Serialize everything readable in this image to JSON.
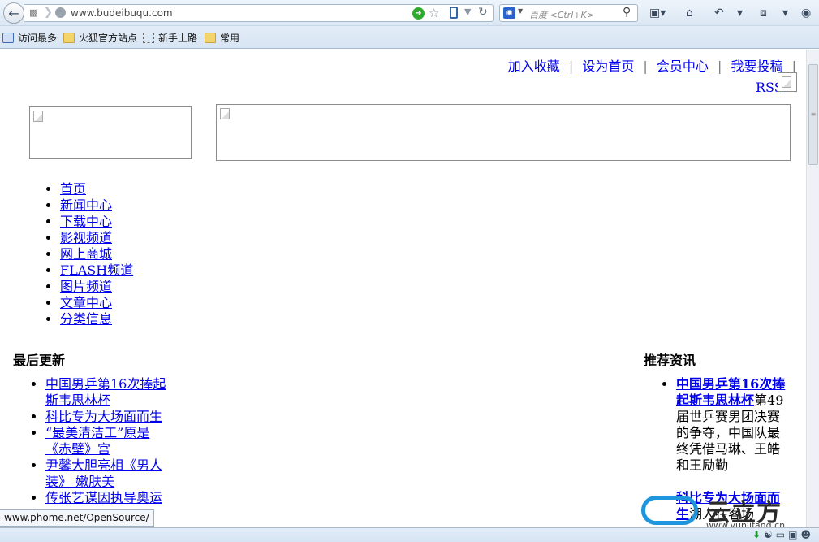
{
  "browser": {
    "url": "www.budeibuqu.com",
    "search_placeholder": "百度 <Ctrl+K>",
    "bookmarks": [
      "访问最多",
      "火狐官方站点",
      "新手上路",
      "常用"
    ],
    "status_url": "www.phome.net/OpenSource/"
  },
  "page": {
    "top_links": [
      "加入收藏",
      "设为首页",
      "会员中心",
      "我要投稿"
    ],
    "top_link_sep": "|",
    "rss": "RSS",
    "nav": [
      "首页",
      "新闻中心",
      "下载中心",
      "影视频道",
      "网上商城",
      "FLASH频道",
      "图片频道",
      "文章中心",
      "分类信息"
    ],
    "latest": {
      "title": "最后更新",
      "items": [
        "中国男乒第16次捧起斯韦思林杯",
        "科比专为大场面而生",
        "“最美清洁工”原是《赤壁》宫",
        "尹馨大胆亮相《男人装》 嫩肤美",
        "传张艺谋因执导奥运"
      ]
    },
    "recommended": {
      "title": "推荐资讯",
      "items": [
        {
          "title": "中国男乒第16次捧起斯韦思林杯",
          "summary": "第49届世乒赛男团决赛的争夺，中国队最终凭借马琳、王皓和王励勤"
        },
        {
          "title": "科比专为大场面而生",
          "summary": "湖人在客场"
        }
      ]
    }
  },
  "watermark": {
    "text": "云立方",
    "sub": "www.yunlifang.cn"
  }
}
